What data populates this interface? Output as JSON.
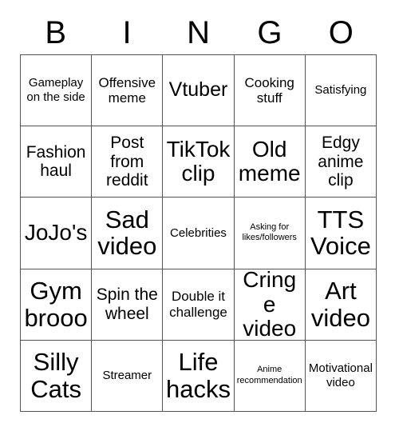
{
  "card": {
    "title": "BINGO",
    "header_letters": [
      "B",
      "I",
      "N",
      "G",
      "O"
    ],
    "grid_size": "5x5",
    "colors": {
      "background": "#ffffff",
      "text": "#000000",
      "grid_line": "#555555"
    }
  },
  "grid": {
    "rows": [
      [
        {
          "label": "Gameplay on the side",
          "size": "xs"
        },
        {
          "label": "Offensive meme",
          "size": "sm"
        },
        {
          "label": "Vtuber",
          "size": "lg"
        },
        {
          "label": "Cooking stuff",
          "size": "sm"
        },
        {
          "label": "Satisfying",
          "size": "xs"
        }
      ],
      [
        {
          "label": "Fashion haul",
          "size": "md"
        },
        {
          "label": "Post from reddit",
          "size": "md"
        },
        {
          "label": "TikTok clip",
          "size": "xl"
        },
        {
          "label": "Old meme",
          "size": "xl"
        },
        {
          "label": "Edgy anime clip",
          "size": "md"
        }
      ],
      [
        {
          "label": "JoJo's",
          "size": "xl"
        },
        {
          "label": "Sad video",
          "size": "xxl"
        },
        {
          "label": "Celebrities",
          "size": "xs"
        },
        {
          "label": "Asking for likes/followers",
          "size": "xxs"
        },
        {
          "label": "TTS Voice",
          "size": "xxl"
        }
      ],
      [
        {
          "label": "Gym brooo",
          "size": "xxl"
        },
        {
          "label": "Spin the wheel",
          "size": "md"
        },
        {
          "label": "Double it challenge",
          "size": "sm"
        },
        {
          "label": "Cringe video",
          "size": "xl"
        },
        {
          "label": "Art video",
          "size": "xxl"
        }
      ],
      [
        {
          "label": "Silly Cats",
          "size": "xxl"
        },
        {
          "label": "Streamer",
          "size": "xs"
        },
        {
          "label": "Life hacks",
          "size": "xxl"
        },
        {
          "label": "Anime recommendation",
          "size": "xxs"
        },
        {
          "label": "Motivational video",
          "size": "xs"
        }
      ]
    ]
  }
}
